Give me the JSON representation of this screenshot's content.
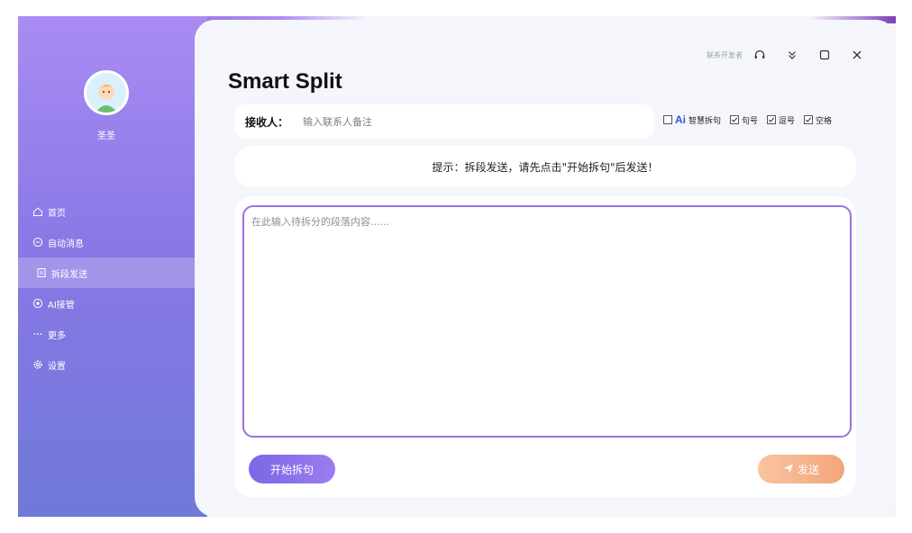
{
  "app": {
    "title": "Smart Split"
  },
  "sidebar": {
    "username": "圣圣",
    "items": [
      {
        "label": "首页",
        "icon": "home-icon"
      },
      {
        "label": "自动消息",
        "icon": "message-icon"
      },
      {
        "label": "拆段发送",
        "icon": "document-icon"
      },
      {
        "label": "AI接管",
        "icon": "ai-icon"
      },
      {
        "label": "更多",
        "icon": "more-icon"
      },
      {
        "label": "设置",
        "icon": "settings-icon"
      }
    ]
  },
  "titlebar": {
    "contact_dev": "联系开发者"
  },
  "receiver": {
    "label": "接收人：",
    "placeholder": "输入联系人备注"
  },
  "options": {
    "ai_mark": "Ai",
    "items": [
      {
        "label": "智慧拆句",
        "checked": false
      },
      {
        "label": "句号",
        "checked": true
      },
      {
        "label": "逗号",
        "checked": true
      },
      {
        "label": "空格",
        "checked": true
      }
    ]
  },
  "hint": {
    "text": "提示：拆段发送，请先点击\"开始拆句\"后发送！"
  },
  "editor": {
    "placeholder": "在此输入待拆分的段落内容......"
  },
  "actions": {
    "start_label": "开始拆句",
    "send_label": "发送"
  },
  "colors": {
    "accent": "#9a72e3",
    "send": "#f3a57c",
    "sidebar_top": "#a98cf3",
    "sidebar_bottom": "#6f79d9"
  }
}
